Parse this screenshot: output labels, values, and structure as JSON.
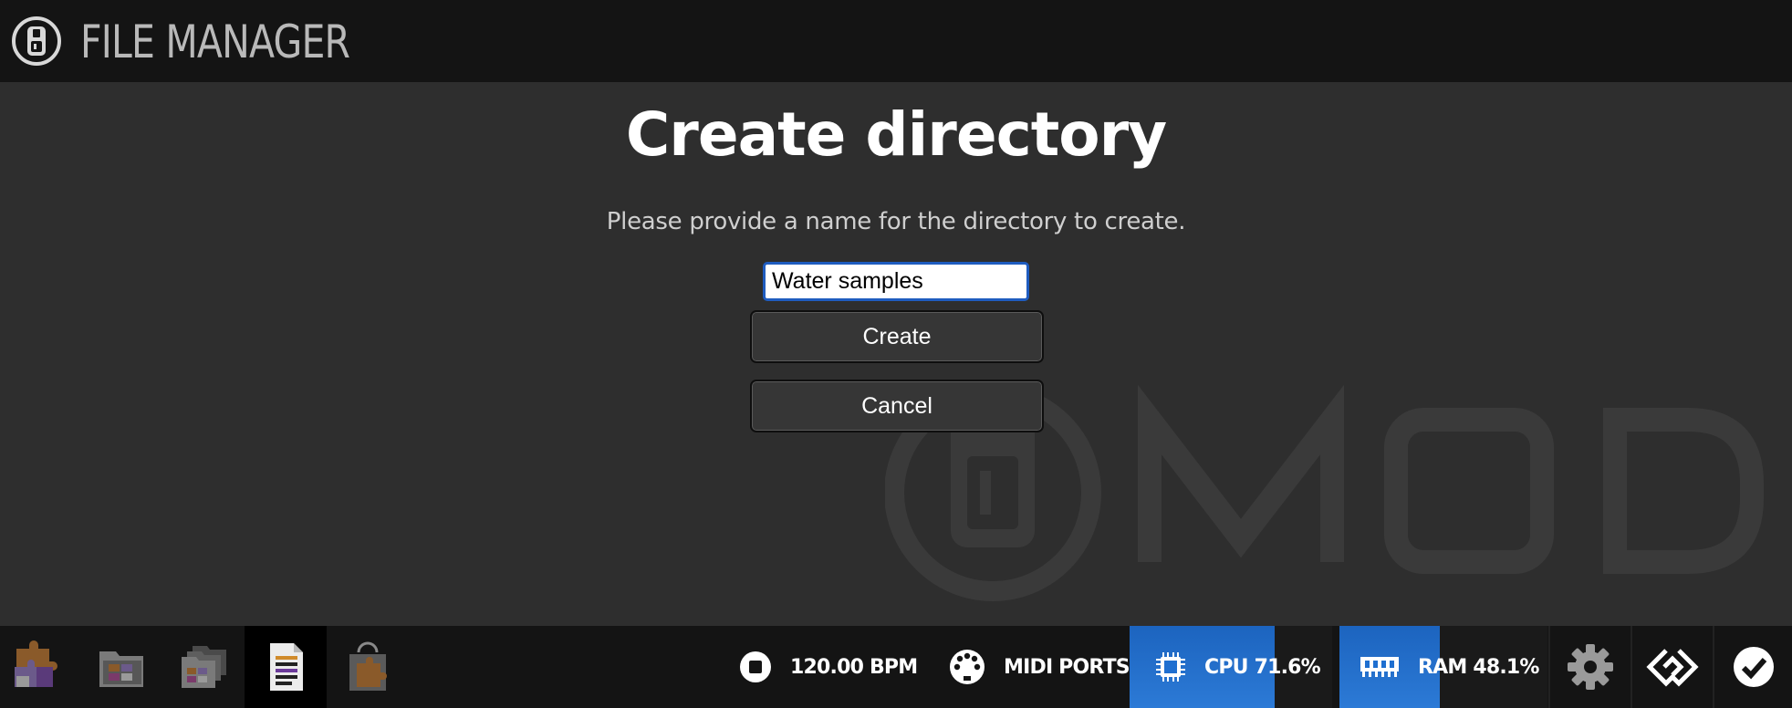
{
  "header": {
    "title": "FILE MANAGER",
    "logo_icon": "mod-logo-icon"
  },
  "watermark": {
    "text": "MOD"
  },
  "dialog": {
    "title": "Create directory",
    "description": "Please provide a name for the directory to create.",
    "input_value": "Water samples",
    "create_label": "Create",
    "cancel_label": "Cancel"
  },
  "dock": {
    "items": [
      {
        "icon": "pedalboard-puzzle-icon",
        "active": false
      },
      {
        "icon": "bank-folder-icon",
        "active": false
      },
      {
        "icon": "banks-stack-icon",
        "active": false
      },
      {
        "icon": "file-manager-icon",
        "active": true
      },
      {
        "icon": "plugin-store-bag-icon",
        "active": false
      }
    ]
  },
  "status": {
    "transport_label": "120.00 BPM",
    "midi_label": "MIDI PORTS",
    "cpu_label": "CPU 71.6%",
    "cpu_percent": 71.6,
    "ram_label": "RAM 48.1%",
    "ram_percent": 48.1,
    "accent": "#1f6fd0"
  }
}
